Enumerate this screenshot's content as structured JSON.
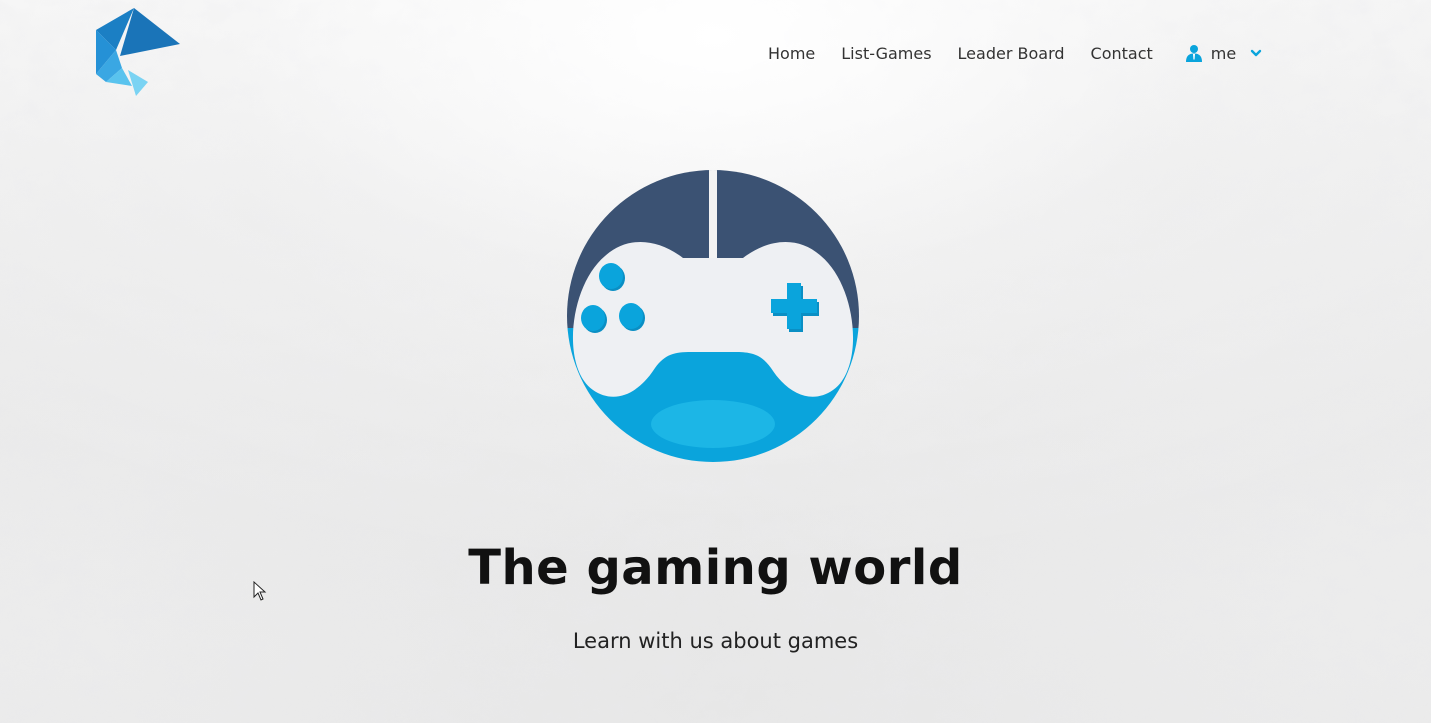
{
  "header": {
    "logo_icon": "brand-triangles-logo",
    "nav": [
      {
        "label": "Home"
      },
      {
        "label": "List-Games"
      },
      {
        "label": "Leader Board"
      },
      {
        "label": "Contact"
      }
    ],
    "user_menu": {
      "icon": "user-icon",
      "label": "me",
      "chevron_icon": "chevron-down-icon"
    }
  },
  "hero": {
    "logo_icon": "gamepad-globe-icon",
    "title": "The gaming world",
    "subtitle": "Learn with us about games"
  },
  "colors": {
    "accent_blue": "#0aa4dc",
    "dark_navy": "#3b5273",
    "logo_blue": "#1b7fc4",
    "logo_light": "#59c3ee"
  }
}
